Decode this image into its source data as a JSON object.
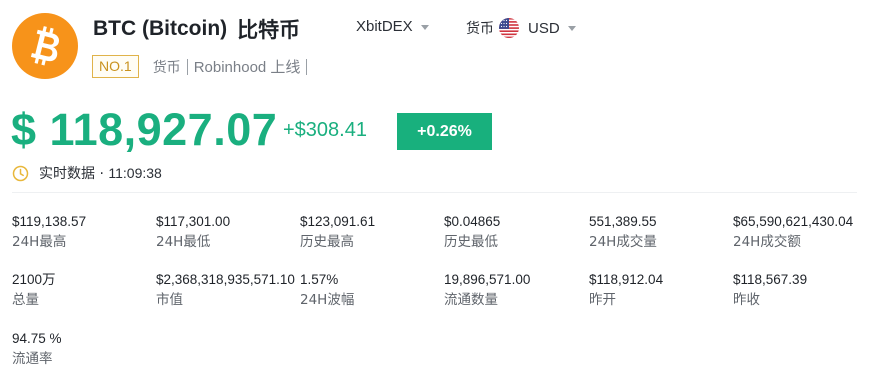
{
  "coin": {
    "symbol_title": "BTC (Bitcoin)",
    "cn_name": "比特币",
    "icon": "bitcoin-logo",
    "brand_color": "#f7931a"
  },
  "header": {
    "exchange": "XbitDEX",
    "currency_label": "货币",
    "currency": "USD",
    "currency_flag": "us-flag-icon"
  },
  "tags": {
    "rank": "NO.1",
    "category": "货币",
    "listed": "Robinhood 上线"
  },
  "price": {
    "value": "$ 118,927.07",
    "change_abs": "+$308.41",
    "change_pct": "+0.26%",
    "up_color": "#1aaf7f"
  },
  "realtime": {
    "label": "实时数据",
    "time": "11:09:38"
  },
  "stats": [
    {
      "value": "$119,138.57",
      "label": "24H最高"
    },
    {
      "value": "$117,301.00",
      "label": "24H最低"
    },
    {
      "value": "$123,091.61",
      "label": "历史最高"
    },
    {
      "value": "$0.04865",
      "label": "历史最低"
    },
    {
      "value": "551,389.55",
      "label": "24H成交量"
    },
    {
      "value": "$65,590,621,430.04",
      "label": "24H成交额"
    },
    {
      "value": "2100万",
      "label": "总量"
    },
    {
      "value": "$2,368,318,935,571.10",
      "label": "市值"
    },
    {
      "value": "1.57%",
      "label": "24H波幅"
    },
    {
      "value": "19,896,571.00",
      "label": "流通数量"
    },
    {
      "value": "$118,912.04",
      "label": "昨开"
    },
    {
      "value": "$118,567.39",
      "label": "昨收"
    },
    {
      "value": "94.75 %",
      "label": "流通率"
    }
  ]
}
